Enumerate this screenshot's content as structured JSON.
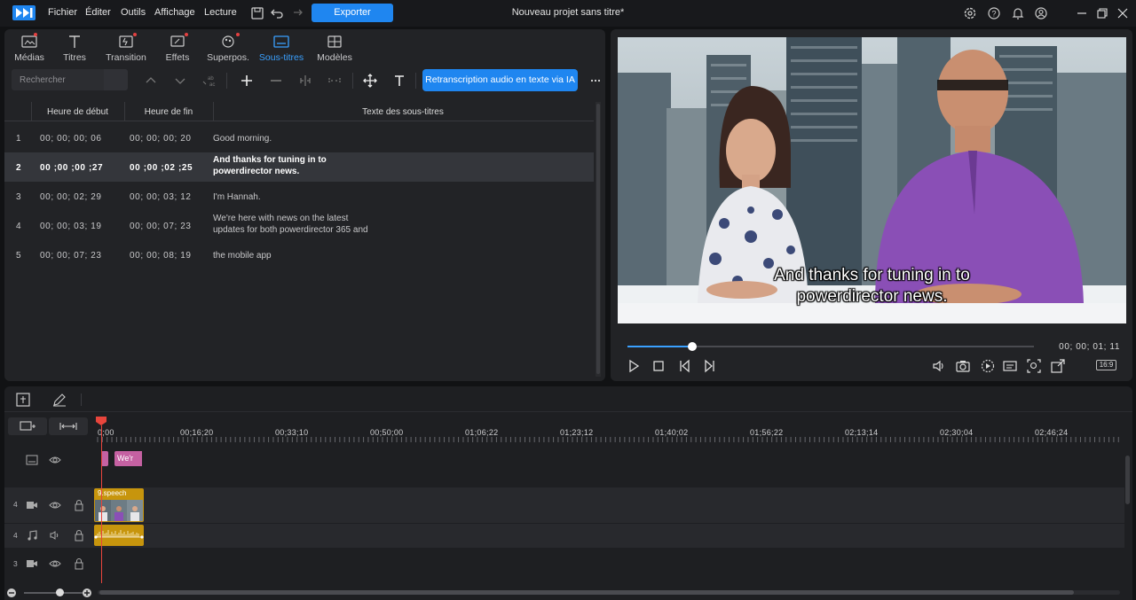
{
  "app": {
    "menu": [
      "Fichier",
      "Éditer",
      "Outils",
      "Affichage",
      "Lecture"
    ],
    "export_label": "Exporter",
    "project_title": "Nouveau projet sans titre*"
  },
  "colors": {
    "accent": "#1f86f0",
    "playhead": "#e8453c",
    "subtitle_clip": "#c561a2",
    "audio_clip": "#c7950d"
  },
  "rooms": [
    {
      "label": "Médias",
      "icon": "media-icon",
      "active": false
    },
    {
      "label": "Titres",
      "icon": "title-icon",
      "active": false
    },
    {
      "label": "Transition",
      "icon": "transition-icon",
      "active": false
    },
    {
      "label": "Effets",
      "icon": "effects-icon",
      "active": false
    },
    {
      "label": "Superpos.",
      "icon": "overlay-icon",
      "active": false
    },
    {
      "label": "Sous-titres",
      "icon": "subtitle-icon",
      "active": true
    },
    {
      "label": "Modèles",
      "icon": "templates-icon",
      "active": false
    }
  ],
  "subtitle_room": {
    "search_placeholder": "Rechercher",
    "ai_button": "Retranscription audio en texte via IA",
    "columns": {
      "start": "Heure de début",
      "end": "Heure de fin",
      "text": "Texte des sous-titres"
    },
    "rows": [
      {
        "num": "1",
        "start": "00; 00; 00; 06",
        "end": "00; 00; 00; 20",
        "text1": "Good morning.",
        "text2": ""
      },
      {
        "num": "2",
        "start": "00 ;00 ;00 ;27",
        "end": "00 ;00 ;02 ;25",
        "text1": "And thanks for tuning in to",
        "text2": "powerdirector news."
      },
      {
        "num": "3",
        "start": "00; 00; 02; 29",
        "end": "00; 00; 03; 12",
        "text1": "I'm Hannah.",
        "text2": ""
      },
      {
        "num": "4",
        "start": "00; 00; 03; 19",
        "end": "00; 00; 07; 23",
        "text1": "We're here with news on the latest",
        "text2": "updates for both powerdirector 365 and"
      },
      {
        "num": "5",
        "start": "00; 00; 07; 23",
        "end": "00; 00; 08; 19",
        "text1": "the mobile app",
        "text2": ""
      }
    ]
  },
  "preview": {
    "subtitle_line1": "And thanks for tuning in to",
    "subtitle_line2": "powerdirector news.",
    "timecode": "00; 00; 01; 11",
    "progress": 0.16,
    "ratio_label": "16:9"
  },
  "timeline": {
    "ruler": [
      "0;00",
      "00;16;20",
      "00;33;10",
      "00;50;00",
      "01;06;22",
      "01;23;12",
      "01;40;02",
      "01;56;22",
      "02;13;14",
      "02;30;04",
      "02;46;24"
    ],
    "subtitle_clip_label": "We'r",
    "video_clip_label": "9.speech",
    "tracks": [
      {
        "num": "4",
        "type": "video"
      },
      {
        "num": "4",
        "type": "audio"
      },
      {
        "num": "3",
        "type": "video"
      }
    ],
    "zoom": 0.6
  }
}
